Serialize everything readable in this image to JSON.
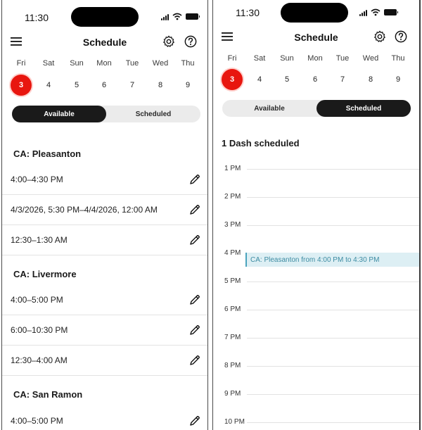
{
  "screens": [
    {
      "status": {
        "time": "11:30"
      },
      "header": {
        "title": "Schedule"
      },
      "week": [
        {
          "day": "Fri",
          "date": "3",
          "selected": true
        },
        {
          "day": "Sat",
          "date": "4",
          "selected": false
        },
        {
          "day": "Sun",
          "date": "5",
          "selected": false
        },
        {
          "day": "Mon",
          "date": "6",
          "selected": false
        },
        {
          "day": "Tue",
          "date": "7",
          "selected": false
        },
        {
          "day": "Wed",
          "date": "8",
          "selected": false
        },
        {
          "day": "Thu",
          "date": "9",
          "selected": false
        }
      ],
      "segments": {
        "available": "Available",
        "scheduled": "Scheduled",
        "active": "available"
      },
      "locations": [
        {
          "name": "CA: Pleasanton",
          "slots": [
            "4:00–4:30 PM",
            "4/3/2026, 5:30 PM–4/4/2026, 12:00 AM",
            "12:30–1:30 AM"
          ]
        },
        {
          "name": "CA: Livermore",
          "slots": [
            "4:00–5:00 PM",
            "6:00–10:30 PM",
            "12:30–4:00 AM"
          ]
        },
        {
          "name": "CA: San Ramon",
          "slots": [
            "4:00–5:00 PM"
          ]
        }
      ]
    },
    {
      "status": {
        "time": "11:30"
      },
      "header": {
        "title": "Schedule"
      },
      "week": [
        {
          "day": "Fri",
          "date": "3",
          "selected": true
        },
        {
          "day": "Sat",
          "date": "4",
          "selected": false
        },
        {
          "day": "Sun",
          "date": "5",
          "selected": false
        },
        {
          "day": "Mon",
          "date": "6",
          "selected": false
        },
        {
          "day": "Tue",
          "date": "7",
          "selected": false
        },
        {
          "day": "Wed",
          "date": "8",
          "selected": false
        },
        {
          "day": "Thu",
          "date": "9",
          "selected": false
        }
      ],
      "segments": {
        "available": "Available",
        "scheduled": "Scheduled",
        "active": "scheduled"
      },
      "summary": "1 Dash scheduled",
      "hours": [
        "1 PM",
        "2 PM",
        "3 PM",
        "4 PM",
        "5 PM",
        "6 PM",
        "7 PM",
        "8 PM",
        "9 PM",
        "10 PM"
      ],
      "event": {
        "label": "CA: Pleasanton from 4:00 PM to 4:30 PM"
      }
    }
  ],
  "colors": {
    "accent": "#e8160f",
    "segment_active": "#1a1a1a",
    "event_bg": "#ddeff4",
    "event_text": "#3c8ba2"
  },
  "icons": {
    "menu": "hamburger-icon",
    "settings": "gear-icon",
    "help": "question-circle-icon",
    "edit": "pencil-icon"
  }
}
